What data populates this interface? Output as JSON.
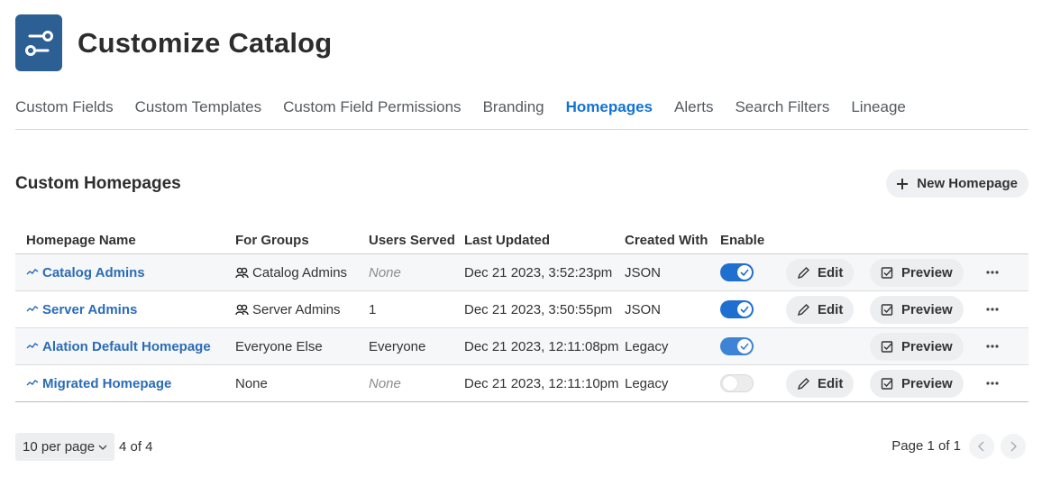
{
  "header": {
    "title": "Customize Catalog",
    "logo_icon": "settings-sliders-icon",
    "logo_color": "#2c5f93"
  },
  "tabs": [
    {
      "label": "Custom Fields",
      "active": false
    },
    {
      "label": "Custom Templates",
      "active": false
    },
    {
      "label": "Custom Field Permissions",
      "active": false
    },
    {
      "label": "Branding",
      "active": false
    },
    {
      "label": "Homepages",
      "active": true
    },
    {
      "label": "Alerts",
      "active": false
    },
    {
      "label": "Search Filters",
      "active": false
    },
    {
      "label": "Lineage",
      "active": false
    }
  ],
  "section": {
    "title": "Custom Homepages",
    "new_button": "New Homepage"
  },
  "table": {
    "columns": [
      "Homepage Name",
      "For Groups",
      "Users Served",
      "Last Updated",
      "Created With",
      "Enable"
    ],
    "rows": [
      {
        "name": "Catalog Admins",
        "groups": "Catalog Admins",
        "users": "None",
        "updated": "Dec 21 2023, 3:52:23pm",
        "created": "JSON",
        "enabled": true,
        "edit": "Edit",
        "preview": "Preview"
      },
      {
        "name": "Server Admins",
        "groups": "Server Admins",
        "users": "1",
        "updated": "Dec 21 2023, 3:50:55pm",
        "created": "JSON",
        "enabled": true,
        "edit": "Edit",
        "preview": "Preview"
      },
      {
        "name": "Alation Default Homepage",
        "groups": "Everyone Else",
        "users": "Everyone",
        "updated": "Dec 21 2023, 12:11:08pm",
        "created": "Legacy",
        "enabled": true,
        "edit": "",
        "preview": "Preview"
      },
      {
        "name": "Migrated Homepage",
        "groups": "None",
        "users": "None",
        "updated": "Dec 21 2023, 12:11:10pm",
        "created": "Legacy",
        "enabled": false,
        "edit": "Edit",
        "preview": "Preview"
      }
    ]
  },
  "pagination": {
    "per_page": "10 per page",
    "count": "4 of 4",
    "page_info": "Page 1 of 1"
  },
  "colors": {
    "accent": "#1173d4",
    "link": "#2b6cb7",
    "toggle_on": "#1f6fd1"
  }
}
